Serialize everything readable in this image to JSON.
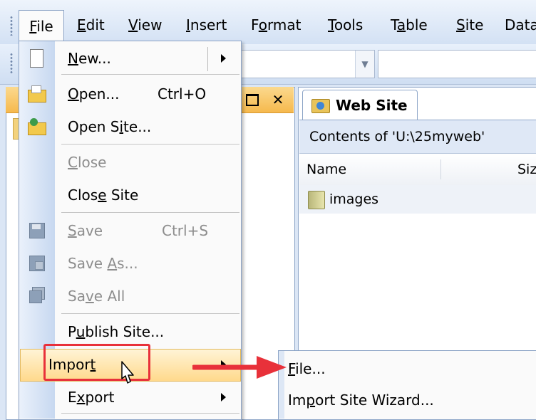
{
  "menubar": {
    "items": [
      {
        "label": "File",
        "access": "F"
      },
      {
        "label": "Edit",
        "access": "E"
      },
      {
        "label": "View",
        "access": "V"
      },
      {
        "label": "Insert",
        "access": "I"
      },
      {
        "label": "Format",
        "access": "o"
      },
      {
        "label": "Tools",
        "access": "T"
      },
      {
        "label": "Table",
        "access": "a"
      },
      {
        "label": "Site",
        "access": "S"
      },
      {
        "label": "Data",
        "access": ""
      }
    ]
  },
  "file_menu": {
    "new": {
      "pre": "",
      "key": "N",
      "post": "ew..."
    },
    "open": {
      "pre": "",
      "key": "O",
      "post": "pen...",
      "shortcut": "Ctrl+O"
    },
    "open_site": {
      "pre": "Open S",
      "key": "i",
      "post": "te..."
    },
    "close": {
      "pre": "",
      "key": "C",
      "post": "lose"
    },
    "close_site": {
      "pre": "Clos",
      "key": "e",
      "post": " Site"
    },
    "save": {
      "pre": "",
      "key": "S",
      "post": "ave",
      "shortcut": "Ctrl+S"
    },
    "save_as": {
      "pre": "Save ",
      "key": "A",
      "post": "s..."
    },
    "save_all": {
      "pre": "Sa",
      "key": "v",
      "post": "e All"
    },
    "publish_site": {
      "pre": "P",
      "key": "u",
      "post": "blish Site..."
    },
    "import": {
      "pre": "Impor",
      "key": "t",
      "post": ""
    },
    "export": {
      "pre": "E",
      "key": "x",
      "post": "port"
    }
  },
  "import_submenu": {
    "file": {
      "pre": "",
      "key": "F",
      "post": "ile..."
    },
    "import_site_wizard": {
      "pre": "Im",
      "key": "p",
      "post": "ort Site Wizard..."
    }
  },
  "web_site_pane": {
    "tab_label": "Web Site",
    "contents_label": "Contents of 'U:\\25myweb'",
    "columns": [
      "Name",
      "Siz"
    ],
    "rows": [
      {
        "name": "images"
      }
    ]
  },
  "colors": {
    "highlight_box": "#e8313a",
    "arrow": "#e8313a",
    "pane_header": "#f6b94d",
    "menu_hover": "#ffd98c"
  }
}
